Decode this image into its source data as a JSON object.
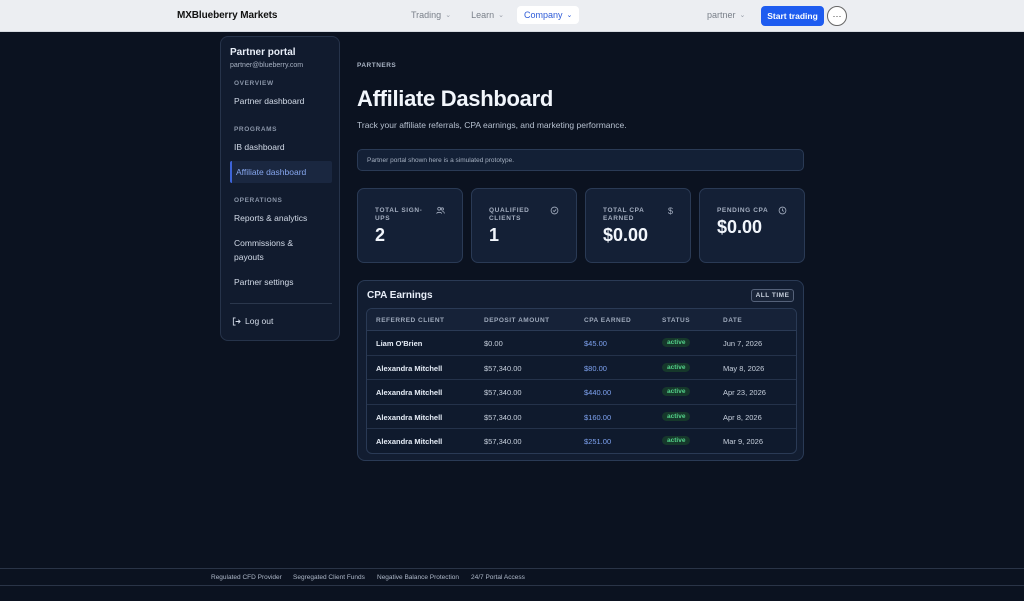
{
  "nav": {
    "brand": "MXBlueberry Markets",
    "links": [
      {
        "label": "Trading"
      },
      {
        "label": "Learn"
      },
      {
        "label": "Company"
      }
    ],
    "partner_label": "partner",
    "start_label": "Start trading",
    "more_label": "···"
  },
  "sidebar": {
    "title": "Partner portal",
    "email": "partner@blueberry.com",
    "sections": {
      "overview": "OVERVIEW",
      "programs": "PROGRAMS",
      "operations": "OPERATIONS"
    },
    "items": {
      "partner_dashboard": "Partner dashboard",
      "ib_dashboard": "IB dashboard",
      "affiliate_dashboard": "Affiliate dashboard",
      "reports": "Reports & analytics",
      "commissions_line1": "Commissions &",
      "commissions_line2": "payouts",
      "settings": "Partner settings"
    },
    "logout": "Log out"
  },
  "main": {
    "eyebrow": "PARTNERS",
    "title": "Affiliate Dashboard",
    "subtitle": "Track your affiliate referrals, CPA earnings, and marketing performance.",
    "notice": "Partner portal shown here is a simulated prototype."
  },
  "kpis": [
    {
      "label": "TOTAL SIGN-UPS",
      "value": "2",
      "icon": "users-icon"
    },
    {
      "label": "QUALIFIED CLIENTS",
      "value": "1",
      "icon": "check-circle-icon"
    },
    {
      "label": "TOTAL CPA EARNED",
      "value": "$0.00",
      "icon": "dollar-icon"
    },
    {
      "label": "PENDING CPA",
      "value": "$0.00",
      "icon": "clock-icon"
    }
  ],
  "earnings": {
    "title": "CPA Earnings",
    "filter": "ALL TIME",
    "columns": [
      "REFERRED CLIENT",
      "DEPOSIT AMOUNT",
      "CPA EARNED",
      "STATUS",
      "DATE"
    ],
    "rows": [
      {
        "client": "Liam O'Brien",
        "deposit": "$0.00",
        "cpa": "$45.00",
        "status": "active",
        "date": "Jun 7, 2026"
      },
      {
        "client": "Alexandra Mitchell",
        "deposit": "$57,340.00",
        "cpa": "$80.00",
        "status": "active",
        "date": "May 8, 2026"
      },
      {
        "client": "Alexandra Mitchell",
        "deposit": "$57,340.00",
        "cpa": "$440.00",
        "status": "active",
        "date": "Apr 23, 2026"
      },
      {
        "client": "Alexandra Mitchell",
        "deposit": "$57,340.00",
        "cpa": "$160.00",
        "status": "active",
        "date": "Apr 8, 2026"
      },
      {
        "client": "Alexandra Mitchell",
        "deposit": "$57,340.00",
        "cpa": "$251.00",
        "status": "active",
        "date": "Mar 9, 2026"
      }
    ]
  },
  "footer": [
    "Regulated CFD Provider",
    "Segregated Client Funds",
    "Negative Balance Protection",
    "24/7 Portal Access"
  ],
  "colors": {
    "accent": "#1e5cf0",
    "background": "#0b1220",
    "status_active": "#53d18a"
  }
}
